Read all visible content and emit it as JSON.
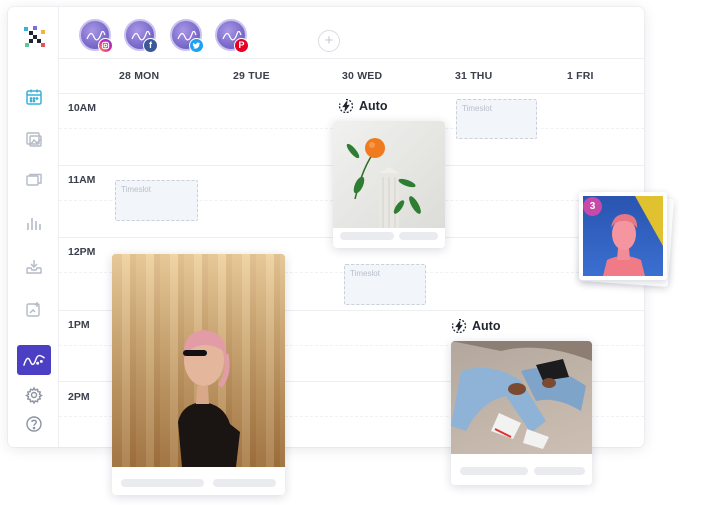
{
  "avatars": [
    {
      "network": "instagram",
      "badge_icon": "instagram-icon",
      "color": "#d6249f"
    },
    {
      "network": "facebook",
      "badge_icon": "facebook-icon",
      "color": "#3b5998",
      "glyph": "f"
    },
    {
      "network": "twitter",
      "badge_icon": "twitter-icon",
      "color": "#1da1f2"
    },
    {
      "network": "pinterest",
      "badge_icon": "pinterest-icon",
      "color": "#e60023",
      "glyph": "P"
    }
  ],
  "add_account_label": "+",
  "days": [
    "28 MON",
    "29 TUE",
    "30 WED",
    "31 THU",
    "1 FRI"
  ],
  "times": [
    "10AM",
    "11AM",
    "12PM",
    "1PM",
    "2PM"
  ],
  "timeslot_label": "Timeslot",
  "auto_label": "Auto",
  "stack_count": "3",
  "sidebar": [
    {
      "icon": "calendar-icon",
      "active": true
    },
    {
      "icon": "gallery-icon"
    },
    {
      "icon": "conversation-icon"
    },
    {
      "icon": "analytics-icon"
    },
    {
      "icon": "inbox-icon"
    },
    {
      "icon": "add-post-icon"
    },
    {
      "icon": "trends-icon",
      "highlighted": true
    },
    {
      "icon": "settings-icon"
    },
    {
      "icon": "help-icon"
    }
  ],
  "colors": {
    "accent": "#4b3fc4",
    "sidebar_icon": "#b4bac6",
    "calendar_active": "#3ab0d9",
    "stack_badge": "#c64aa8"
  }
}
